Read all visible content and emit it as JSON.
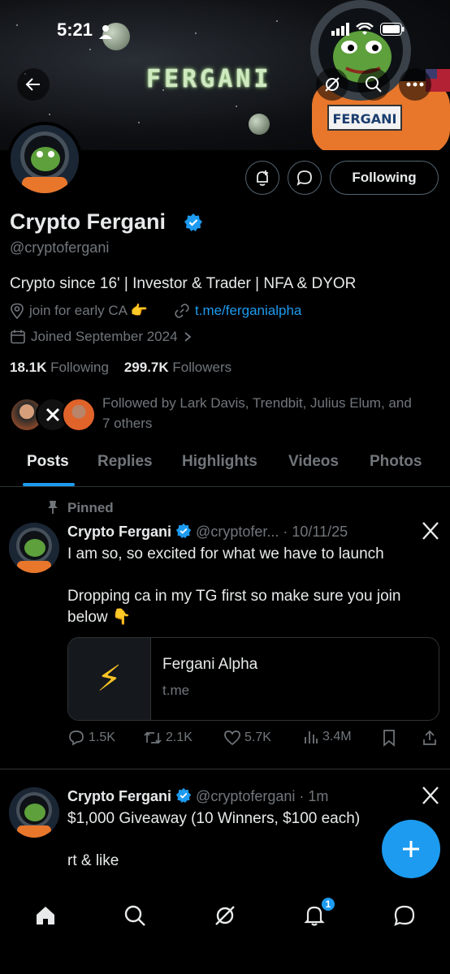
{
  "status_bar": {
    "time": "5:21"
  },
  "banner": {
    "title": "FERGANI",
    "suit_label": "FERGANI"
  },
  "profile": {
    "display_name": "Crypto Fergani",
    "handle": "@cryptofergani",
    "bio": "Crypto since 16' | Investor & Trader | NFA & DYOR",
    "location": "join for early CA 👉",
    "website": "t.me/ferganialpha",
    "joined": "Joined September 2024",
    "following_count": "18.1K",
    "following_label": "Following",
    "followers_count": "299.7K",
    "followers_label": "Followers",
    "followed_by_line1": "Followed by Lark Davis, Trendbit, Julius Elum, and",
    "followed_by_line2": "7 others",
    "following_button": "Following"
  },
  "tabs": [
    {
      "label": "Posts",
      "active": true
    },
    {
      "label": "Replies"
    },
    {
      "label": "Highlights"
    },
    {
      "label": "Videos"
    },
    {
      "label": "Photos"
    }
  ],
  "posts": [
    {
      "pinned_label": "Pinned",
      "author": "Crypto Fergani",
      "handle": "@cryptofer...",
      "time": "· 10/11/25",
      "text_line1": "I am so, so excited for what we have to launch",
      "text_line2": "Dropping ca in my TG first so make sure you join",
      "text_line3": "below 👇",
      "link_card": {
        "title": "Fergani Alpha",
        "domain": "t.me",
        "thumb": "⚡"
      },
      "replies": "1.5K",
      "reposts": "2.1K",
      "likes": "5.7K",
      "views": "3.4M"
    },
    {
      "author": "Crypto Fergani",
      "handle": "@cryptofergani",
      "time": "· 1m",
      "text_line1": "$1,000 Giveaway (10 Winners, $100 each)",
      "text_line2": "rt & like"
    }
  ],
  "bottom_nav": {
    "notifications_badge": "1"
  },
  "colors": {
    "accent": "#1d9bf0",
    "muted": "#71767b",
    "border": "#2f3336",
    "background": "#000000"
  }
}
